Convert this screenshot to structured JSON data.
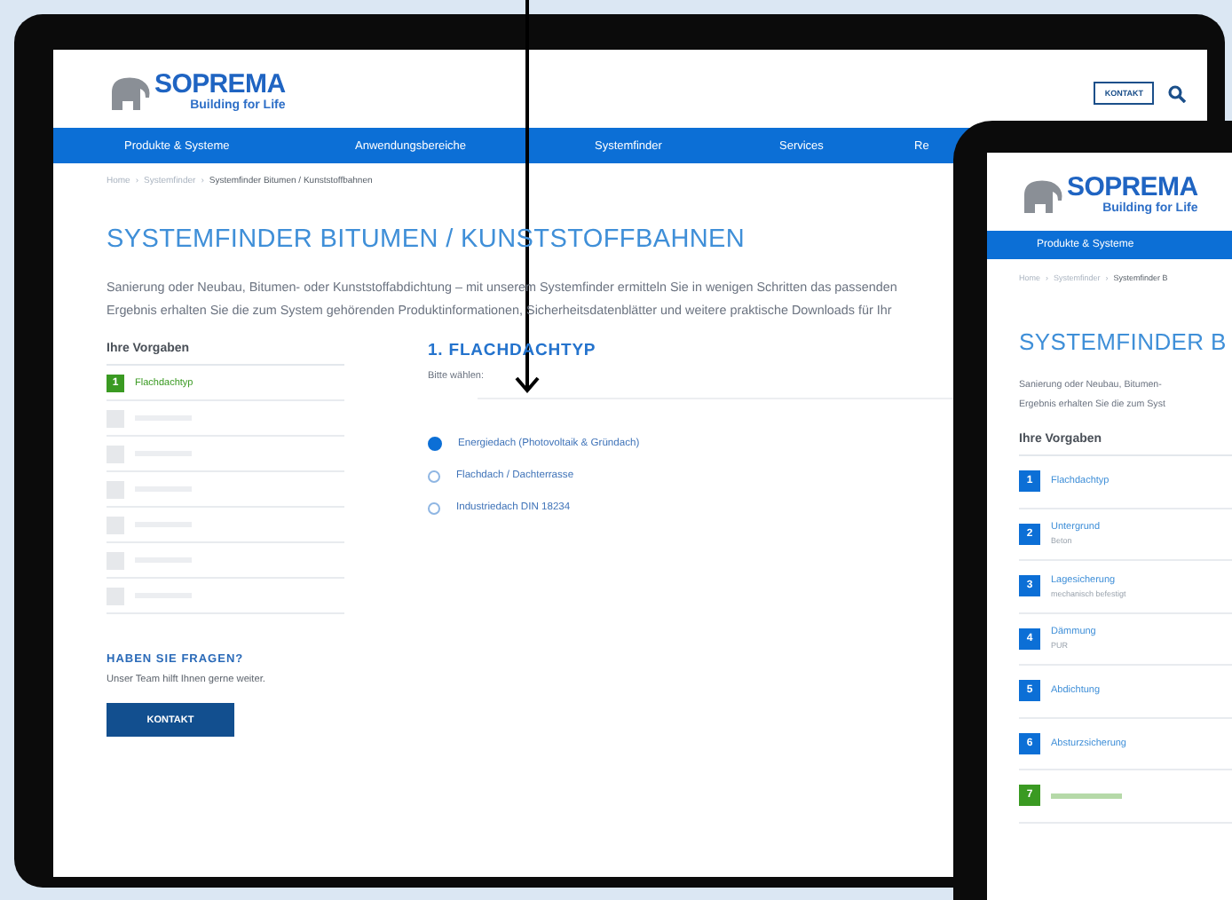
{
  "tablets": [
    {
      "kind": "large",
      "logo": {
        "name": "SOPREMA",
        "tagline": "Building for Life"
      },
      "header_button": "KONTAKT",
      "nav": [
        "Produkte & Systeme",
        "Anwendungsbereiche",
        "Systemfinder",
        "Services",
        "Re"
      ],
      "breadcrumb": {
        "separator": "›",
        "items": [
          "Home",
          "Systemfinder",
          "Systemfinder Bitumen / Kunststoffbahnen"
        ]
      },
      "title": "SYSTEMFINDER BITUMEN / KUNSTSTOFFBAHNEN",
      "intro": [
        "Sanierung oder Neubau, Bitumen- oder Kunststoffabdichtung – mit unserem Systemfinder ermitteln Sie in wenigen Schritten das passenden",
        "Ergebnis erhalten Sie die zum System gehörenden Produktinformationen, Sicherheitsdatenblätter und weitere praktische Downloads für Ihr"
      ],
      "sidebar": {
        "heading": "Ihre Vorgaben",
        "steps": [
          {
            "number": "1",
            "label": "Flachdachtyp",
            "current": true
          },
          {
            "current": false,
            "done": false
          },
          {
            "current": false,
            "done": false
          },
          {
            "current": false,
            "done": false
          },
          {
            "current": false,
            "done": false
          },
          {
            "current": false,
            "done": false
          },
          {
            "current": false,
            "done": false
          }
        ]
      },
      "step_panel": {
        "title": "1. FLACHDACHTYP",
        "prompt": "Bitte wählen:",
        "options": [
          {
            "label": "Energiedach (Photovoltaik & Gründach)",
            "selected": true
          },
          {
            "label": "Flachdach / Dachterrasse",
            "selected": false
          },
          {
            "label": "Industriedach DIN 18234",
            "selected": false
          }
        ]
      },
      "help": {
        "heading": "HABEN SIE FRAGEN?",
        "text": "Unser Team hilft Ihnen gerne weiter.",
        "button": "KONTAKT"
      }
    },
    {
      "kind": "small",
      "logo": {
        "name": "SOPREMA",
        "tagline": "Building for Life"
      },
      "nav": [
        "Produkte & Systeme"
      ],
      "breadcrumb": {
        "separator": "›",
        "items": [
          "Home",
          "Systemfinder",
          "Systemfinder B"
        ]
      },
      "title": "SYSTEMFINDER B",
      "intro": [
        "Sanierung oder Neubau, Bitumen-",
        "Ergebnis erhalten Sie die zum Syst"
      ],
      "sidebar": {
        "heading": "Ihre Vorgaben",
        "steps": [
          {
            "number": "1",
            "label": "Flachdachtyp",
            "current": false,
            "done": true
          },
          {
            "number": "2",
            "label": "Untergrund",
            "detail": "Beton",
            "current": false,
            "done": true
          },
          {
            "number": "3",
            "label": "Lagesicherung",
            "detail": "mechanisch befestigt",
            "current": false,
            "done": true
          },
          {
            "number": "4",
            "label": "Dämmung",
            "detail": "PUR",
            "current": false,
            "done": true
          },
          {
            "number": "5",
            "label": "Abdichtung",
            "current": false,
            "done": true
          },
          {
            "number": "6",
            "label": "Absturzsicherung",
            "current": false,
            "done": true
          },
          {
            "number": "7",
            "current": true
          }
        ]
      }
    }
  ]
}
